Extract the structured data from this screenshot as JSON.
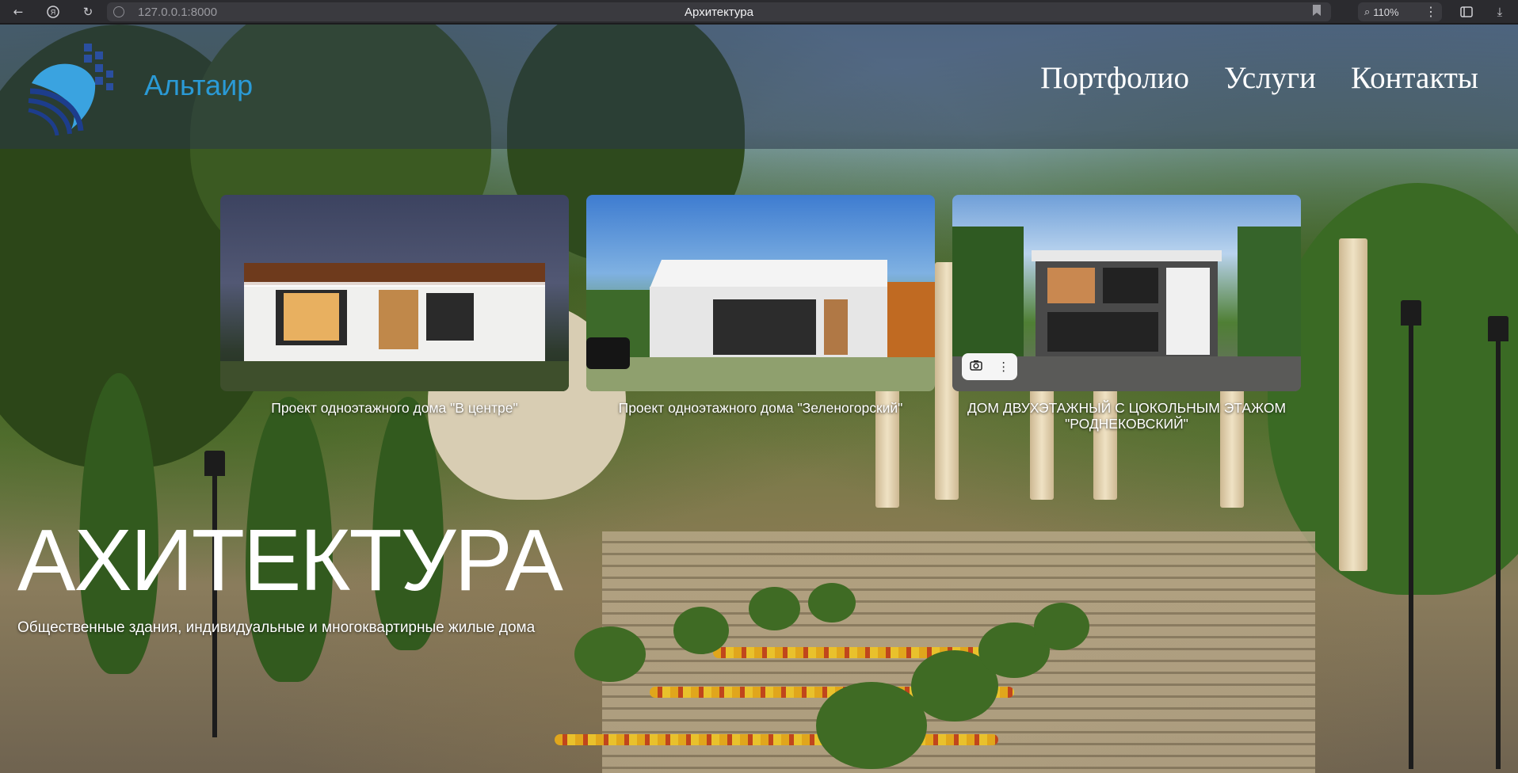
{
  "browser": {
    "url": "127.0.0.1:8000",
    "tab_title": "Архитектура",
    "zoom": "110%",
    "icons": [
      "back-icon",
      "yandex-icon",
      "reload-icon",
      "site-info-icon",
      "bookmark-icon",
      "zoom-icon",
      "more-icon",
      "extensions-icon",
      "download-icon"
    ]
  },
  "header": {
    "logo_text": "Альтаир",
    "nav": [
      "Портфолио",
      "Услуги",
      "Контакты"
    ]
  },
  "projects": [
    {
      "caption": "Проект одноэтажного дома \"В центре\""
    },
    {
      "caption": "Проект одноэтажного дома \"Зеленогорский\""
    },
    {
      "caption": "ДОМ ДВУХЭТАЖНЫЙ С ЦОКОЛЬНЫМ ЭТАЖОМ \"РОДНЕКОВСКИЙ\""
    }
  ],
  "hero": {
    "title": "АХИТЕКТУРА",
    "subtitle": "Общественные здания, индивидуальные и многоквартирные жилые дома"
  },
  "colors": {
    "logo": "#2a9ad6",
    "header_overlay": "#2a3648"
  }
}
